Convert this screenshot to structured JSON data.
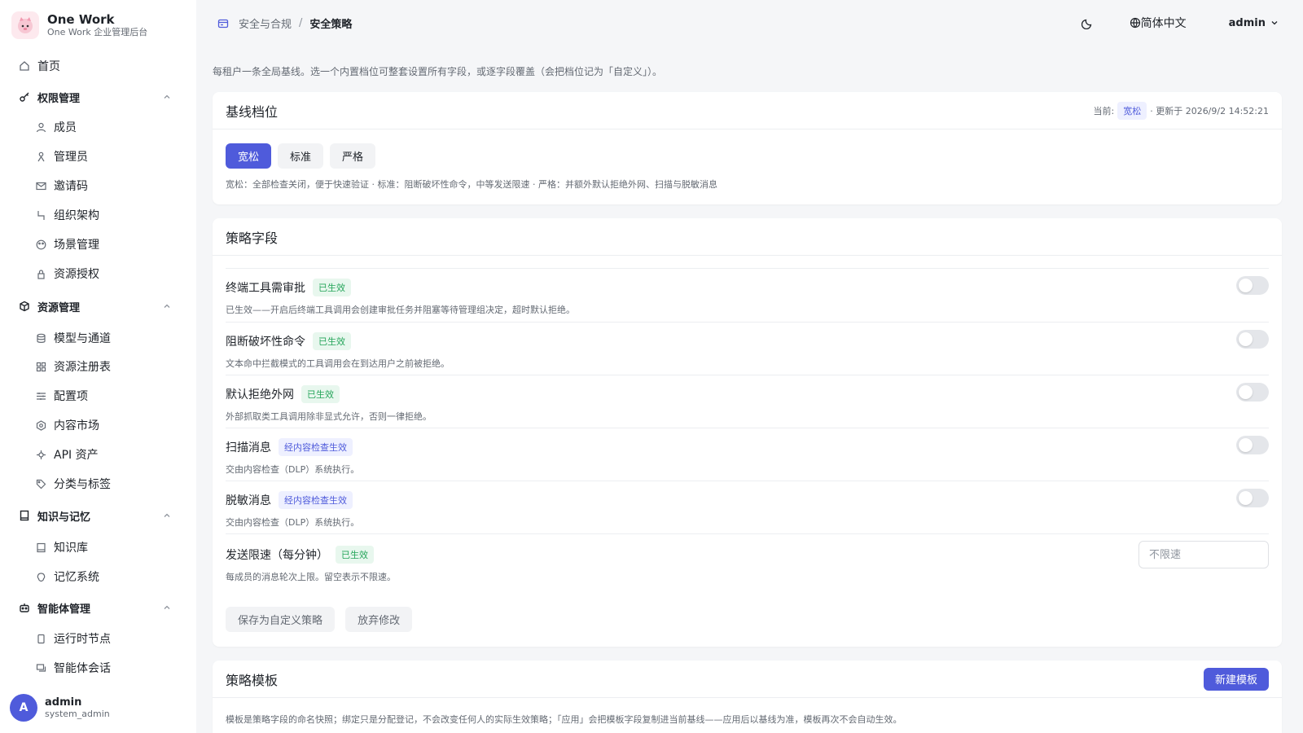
{
  "brand": {
    "title": "One Work",
    "subtitle": "One Work 企业管理后台"
  },
  "nav": {
    "home": "首页",
    "groups": [
      {
        "label": "权限管理",
        "items": [
          "成员",
          "管理员",
          "邀请码",
          "组织架构",
          "场景管理",
          "资源授权"
        ]
      },
      {
        "label": "资源管理",
        "items": [
          "模型与通道",
          "资源注册表",
          "配置项",
          "内容市场",
          "API 资产",
          "分类与标签"
        ]
      },
      {
        "label": "知识与记忆",
        "items": [
          "知识库",
          "记忆系统"
        ]
      },
      {
        "label": "智能体管理",
        "items": [
          "运行时节点",
          "智能体会话"
        ]
      }
    ]
  },
  "user": {
    "initial": "A",
    "name": "admin",
    "role": "system_admin"
  },
  "header": {
    "breadcrumb": [
      "安全与合规",
      "安全策略"
    ],
    "separator": "/",
    "language": "简体中文",
    "account": "admin"
  },
  "intro": "每租户一条全局基线。选一个内置档位可整套设置所有字段，或逐字段覆盖（会把档位记为「自定义」）。",
  "baseline": {
    "title": "基线档位",
    "current_label": "当前:",
    "current_value": "宽松",
    "updated": "· 更新于 2026/9/2 14:52:21",
    "options": [
      "宽松",
      "标准",
      "严格"
    ],
    "active_index": 0,
    "description": "宽松：全部检查关闭，便于快速验证 · 标准：阻断破坏性命令，中等发送限速 · 严格：并额外默认拒绝外网、扫描与脱敏消息"
  },
  "policy": {
    "title": "策略字段",
    "fields": [
      {
        "label": "终端工具需审批",
        "tag": "已生效",
        "tag_type": "green",
        "desc": "已生效——开启后终端工具调用会创建审批任务并阻塞等待管理组决定，超时默认拒绝。",
        "enabled": false
      },
      {
        "label": "阻断破坏性命令",
        "tag": "已生效",
        "tag_type": "green",
        "desc": "文本命中拦截模式的工具调用会在到达用户之前被拒绝。",
        "enabled": false
      },
      {
        "label": "默认拒绝外网",
        "tag": "已生效",
        "tag_type": "green",
        "desc": "外部抓取类工具调用除非显式允许，否则一律拒绝。",
        "enabled": false
      },
      {
        "label": "扫描消息",
        "tag": "经内容检查生效",
        "tag_type": "blue",
        "desc": "交由内容检查（DLP）系统执行。",
        "enabled": false
      },
      {
        "label": "脱敏消息",
        "tag": "经内容检查生效",
        "tag_type": "blue",
        "desc": "交由内容检查（DLP）系统执行。",
        "enabled": false
      }
    ],
    "rate": {
      "label": "发送限速（每分钟）",
      "tag": "已生效",
      "desc": "每成员的消息轮次上限。留空表示不限速。",
      "placeholder": "不限速"
    },
    "save_label": "保存为自定义策略",
    "discard_label": "放弃修改"
  },
  "templates": {
    "title": "策略模板",
    "new_label": "新建模板",
    "description": "模板是策略字段的命名快照；绑定只是分配登记，不会改变任何人的实际生效策略；「应用」会把模板字段复制进当前基线——应用后以基线为准，模板再次不会自动生效。"
  },
  "colors": {
    "accent": "#4f5bdb",
    "success": "#25a55a",
    "background": "#f5f6f8"
  },
  "icons": {
    "home": "home-icon",
    "permission": "key-icon",
    "resource": "cube-icon",
    "knowledge": "book-icon",
    "agent": "robot-icon",
    "theme": "moon-icon",
    "language": "globe-icon",
    "breadcrumb": "shield-card-icon"
  }
}
